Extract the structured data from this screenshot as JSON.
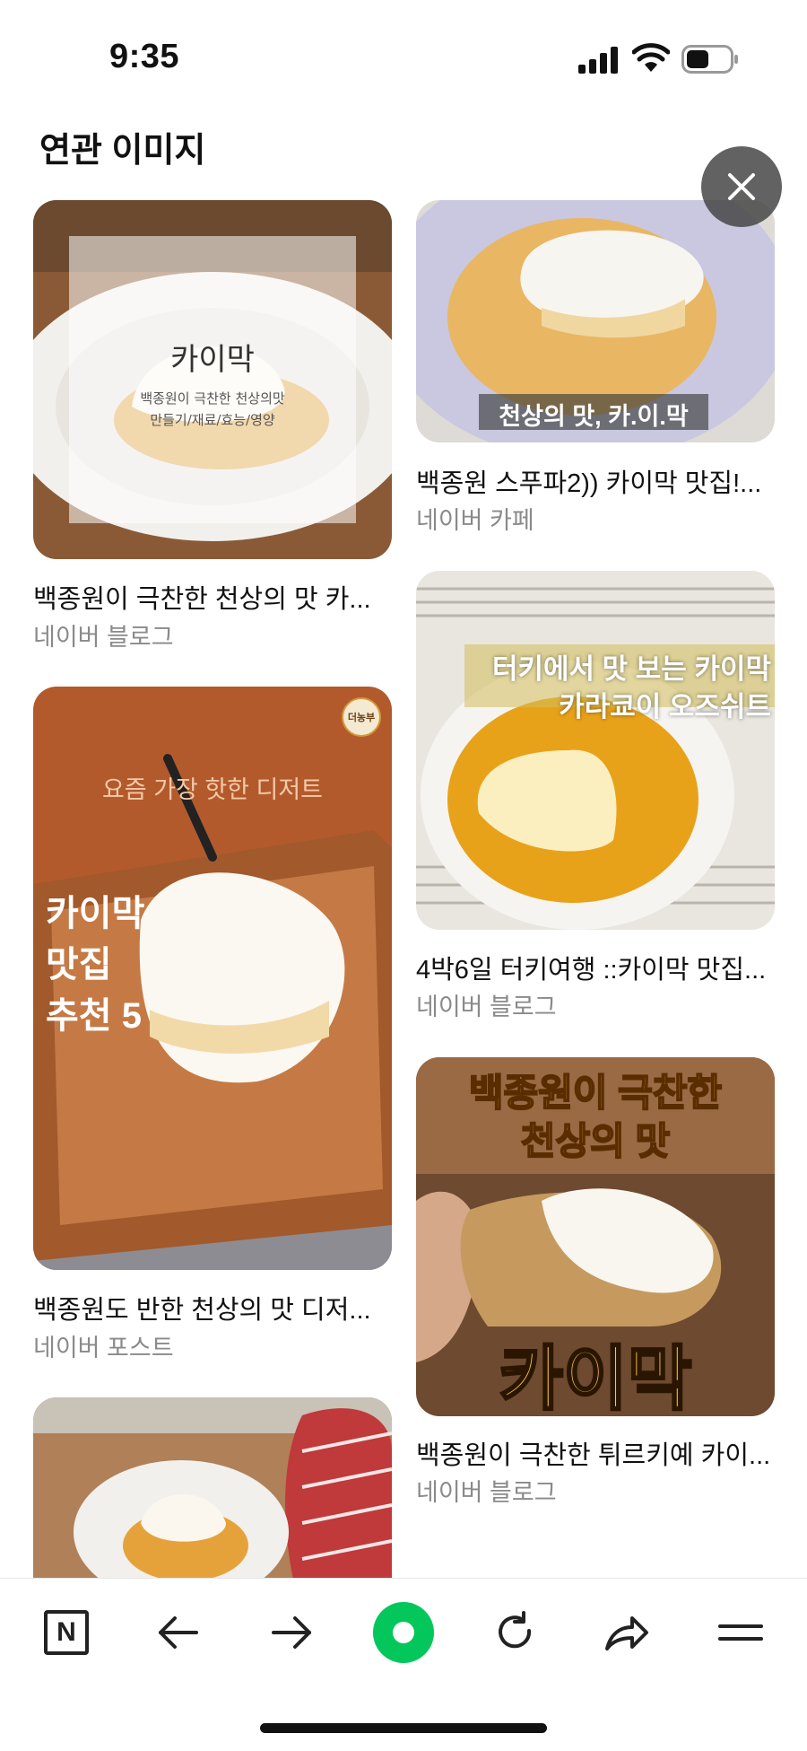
{
  "status_bar": {
    "time": "9:35"
  },
  "section_title": "연관 이미지",
  "cards": [
    {
      "title": "백종원이 극찬한 천상의 맛 카...",
      "source": "네이버 블로그",
      "overlay_main": "카이막",
      "overlay_sub1": "백종원이 극찬한 천상의맛",
      "overlay_sub2": "만들기/재료/효능/영양"
    },
    {
      "title": "백종원 스푸파2)) 카이막 맛집!...",
      "source": "네이버 카페",
      "overlay_caption": "천상의 맛, 카.이.막"
    },
    {
      "title": "4박6일 터키여행 ::카이막 맛집...",
      "source": "네이버 블로그",
      "overlay_line1": "터키에서 맛 보는 카이막",
      "overlay_line2": "카라쿄이 오즈쉬트"
    },
    {
      "title": "백종원도 반한 천상의 맛 디저...",
      "source": "네이버 포스트",
      "overlay_top": "요즘 가장 핫한 디저트",
      "overlay_l1": "카이막",
      "overlay_l2": "맛집",
      "overlay_l3": "추천 5",
      "badge": "더농부"
    },
    {
      "title": "백종원이 극찬한 튀르키예 카이...",
      "source": "네이버 블로그",
      "overlay_top1": "백종원이 극찬한",
      "overlay_top2": "천상의 맛",
      "overlay_bottom": "카이막"
    }
  ],
  "toolbar": {
    "items": [
      "naver-home",
      "back",
      "forward",
      "green-dot",
      "refresh",
      "share",
      "menu"
    ],
    "naver_letter": "N"
  },
  "colors": {
    "accent_green": "#03c75a",
    "source_gray": "#8a8a8a"
  }
}
